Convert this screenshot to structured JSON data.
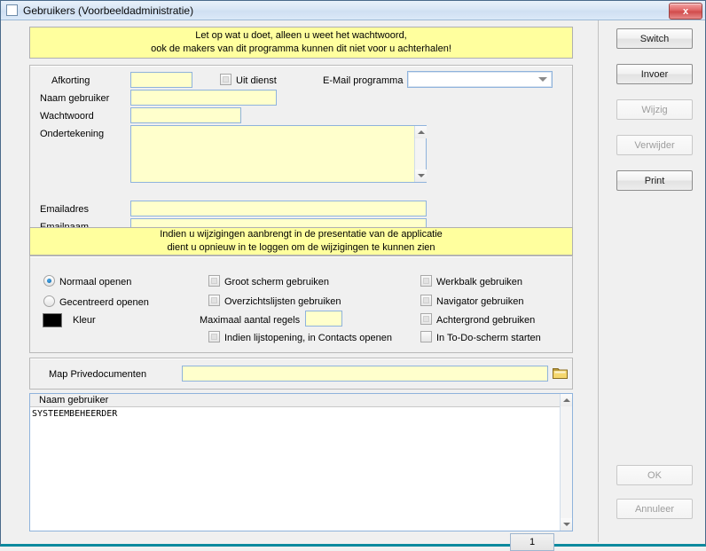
{
  "window": {
    "title": "Gebruikers (Voorbeeldadministratie)",
    "close_label": "x",
    "app_icon": "window-icon"
  },
  "warning_banner": {
    "line1": "Let op wat u doet, alleen u weet het wachtwoord,",
    "line2": "ook de makers van dit programma kunnen dit niet voor u achterhalen!"
  },
  "user_form": {
    "fields": [
      {
        "label": "Afkorting",
        "value": ""
      },
      {
        "label": "Naam gebruiker",
        "value": ""
      },
      {
        "label": "Wachtwoord",
        "value": ""
      },
      {
        "label": "Ondertekening",
        "value": ""
      },
      {
        "label": "Emailadres",
        "value": ""
      },
      {
        "label": "Emailnaam",
        "value": ""
      }
    ],
    "uit_dienst_label": "Uit dienst",
    "uit_dienst_checked": false,
    "email_program_label": "E-Mail programma",
    "email_program_value": ""
  },
  "presentation_banner": {
    "line1": "Indien u wijzigingen aanbrengt in de presentatie van de applicatie",
    "line2": "dient u opnieuw in te loggen om de wijzigingen te kunnen zien"
  },
  "options": {
    "radios": [
      {
        "label": "Normaal openen",
        "checked": true
      },
      {
        "label": "Gecentreerd openen",
        "checked": false
      }
    ],
    "color_label": "Kleur",
    "color_value": "#000000",
    "column_middle": [
      {
        "label": "Groot scherm gebruiken",
        "checked": false
      },
      {
        "label": "Overzichtslijsten gebruiken",
        "checked": false
      },
      {
        "label": "Indien lijstopening, in Contacts openen",
        "checked": false
      }
    ],
    "max_rows_label": "Maximaal aantal regels",
    "max_rows_value": "",
    "column_right": [
      {
        "label": "Werkbalk gebruiken",
        "checked": false
      },
      {
        "label": "Navigator gebruiken",
        "checked": false
      },
      {
        "label": "Achtergrond gebruiken",
        "checked": false
      },
      {
        "label": "In To-Do-scherm starten",
        "checked": false
      }
    ]
  },
  "private_docs": {
    "label": "Map Privedocumenten",
    "value": "",
    "browse_icon": "folder-icon"
  },
  "user_list": {
    "header": "Naam gebruiker",
    "rows": [
      "SYSTEEMBEHEERDER"
    ],
    "page_number": "1"
  },
  "action_buttons": [
    {
      "label": "Switch",
      "enabled": true
    },
    {
      "label": "Invoer",
      "enabled": true
    },
    {
      "label": "Wijzig",
      "enabled": false
    },
    {
      "label": "Verwijder",
      "enabled": false
    },
    {
      "label": "Print",
      "enabled": true
    }
  ],
  "footer_buttons": [
    {
      "label": "OK",
      "enabled": false
    },
    {
      "label": "Annuleer",
      "enabled": false
    }
  ],
  "colors": {
    "field_bg": "#ffffcc",
    "banner_bg": "#ffff9e",
    "accent_border": "#8fb3dc",
    "bottom_accent": "#0c8a9e"
  }
}
